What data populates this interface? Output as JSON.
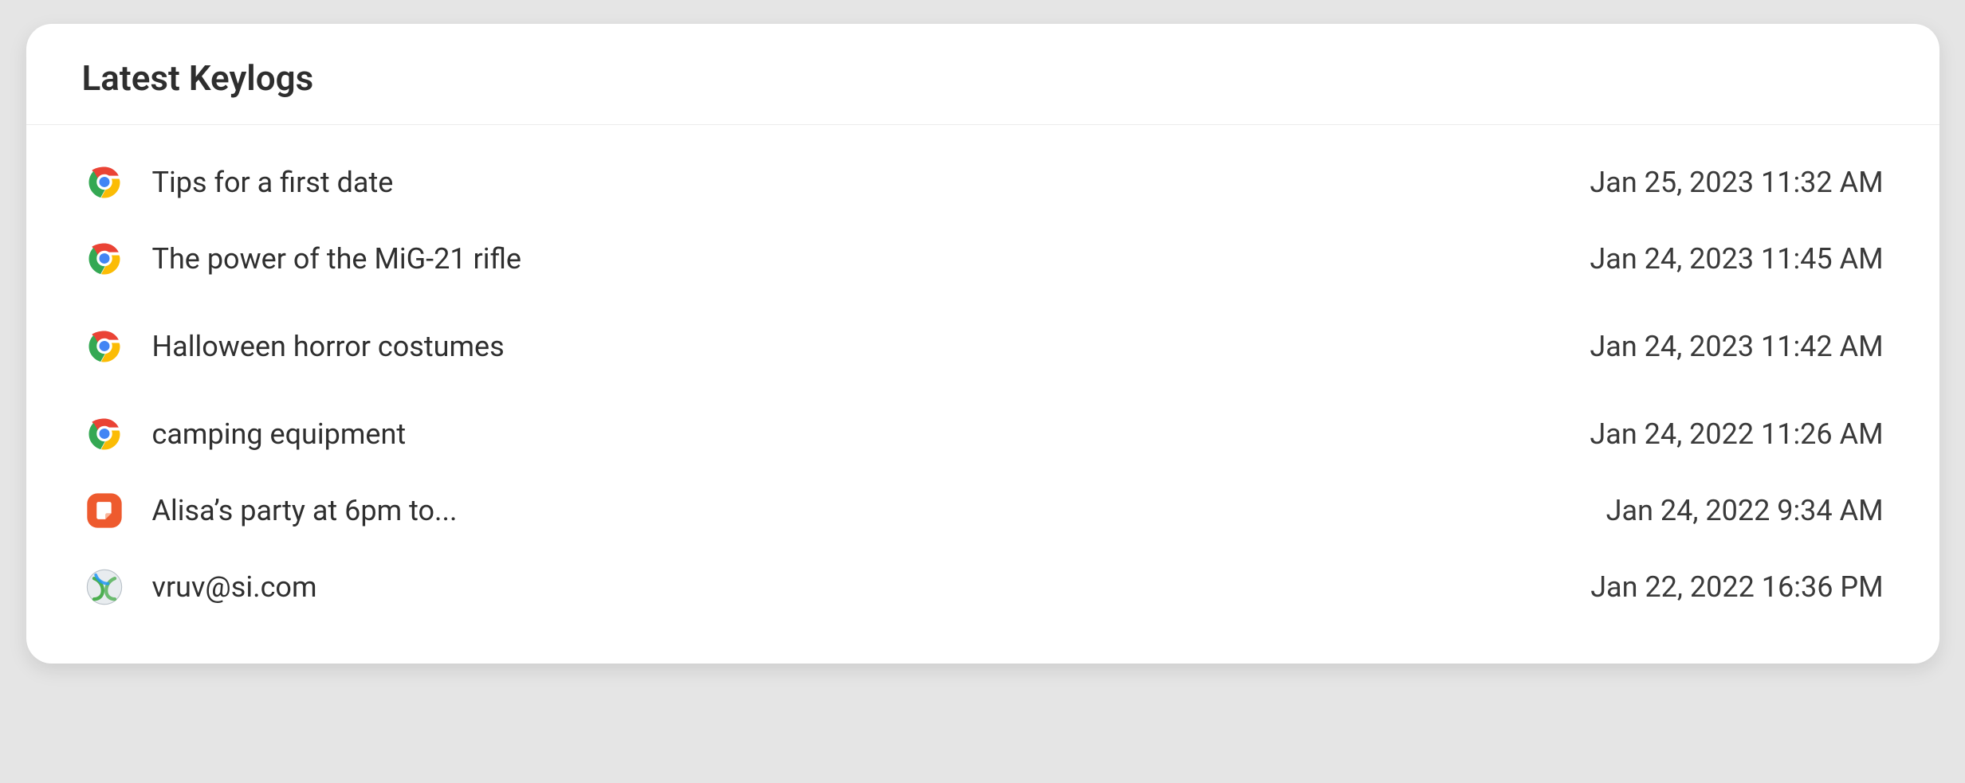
{
  "card": {
    "title": "Latest Keylogs"
  },
  "rows": [
    {
      "icon": "chrome",
      "text": "Tips for a first date",
      "time": "Jan 25, 2023 11:32 AM"
    },
    {
      "icon": "chrome",
      "text": "The power of the MiG-21 rifle",
      "time": "Jan 24, 2023 11:45 AM"
    },
    {
      "icon": "chrome",
      "text": "Halloween horror costumes",
      "time": "Jan 24, 2023 11:42 AM"
    },
    {
      "icon": "chrome",
      "text": "camping equipment",
      "time": "Jan 24, 2022 11:26 AM"
    },
    {
      "icon": "note",
      "text": "Alisa’s party at 6pm to...",
      "time": "Jan 24, 2022 9:34 AM"
    },
    {
      "icon": "globe",
      "text": "vruv@si.com",
      "time": "Jan 22, 2022 16:36 PM"
    }
  ]
}
